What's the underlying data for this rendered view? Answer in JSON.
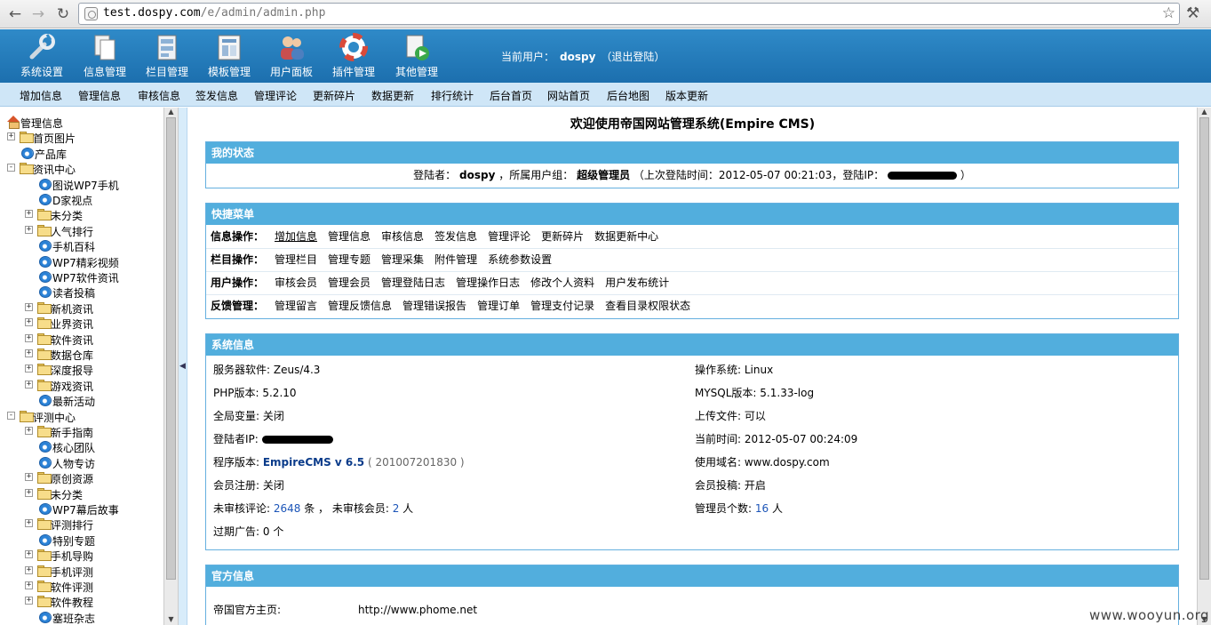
{
  "browser": {
    "url_host": "test.dospy.com",
    "url_path": "/e/admin/admin.php"
  },
  "topbar": {
    "items": [
      {
        "label": "系统设置",
        "icon": "wrench-icon"
      },
      {
        "label": "信息管理",
        "icon": "documents-icon"
      },
      {
        "label": "栏目管理",
        "icon": "column-icon"
      },
      {
        "label": "模板管理",
        "icon": "template-icon"
      },
      {
        "label": "用户面板",
        "icon": "users-icon"
      },
      {
        "label": "插件管理",
        "icon": "lifebuoy-icon"
      },
      {
        "label": "其他管理",
        "icon": "play-document-icon"
      }
    ],
    "user_prefix": "当前用户：",
    "user_name": "dospy",
    "logout": "（退出登陆）"
  },
  "subnav": [
    "增加信息",
    "管理信息",
    "审核信息",
    "签发信息",
    "管理评论",
    "更新碎片",
    "数据更新",
    "排行统计",
    "后台首页",
    "网站首页",
    "后台地图",
    "版本更新"
  ],
  "tree": [
    {
      "label": "管理信息",
      "level": 0,
      "icon": "home",
      "exp": ""
    },
    {
      "label": "首页图片",
      "level": 1,
      "icon": "folder",
      "exp": "+"
    },
    {
      "label": "产品库",
      "level": 1,
      "icon": "ie",
      "exp": ""
    },
    {
      "label": "资讯中心",
      "level": 1,
      "icon": "folder",
      "exp": "-"
    },
    {
      "label": "图说WP7手机",
      "level": 2,
      "icon": "ie",
      "exp": ""
    },
    {
      "label": "D家视点",
      "level": 2,
      "icon": "ie",
      "exp": ""
    },
    {
      "label": "未分类",
      "level": 2,
      "icon": "folder",
      "exp": "+"
    },
    {
      "label": "人气排行",
      "level": 2,
      "icon": "folder",
      "exp": "+"
    },
    {
      "label": "手机百科",
      "level": 2,
      "icon": "ie",
      "exp": ""
    },
    {
      "label": "WP7精彩视频",
      "level": 2,
      "icon": "ie",
      "exp": ""
    },
    {
      "label": "WP7软件资讯",
      "level": 2,
      "icon": "ie",
      "exp": ""
    },
    {
      "label": "读者投稿",
      "level": 2,
      "icon": "ie",
      "exp": ""
    },
    {
      "label": "新机资讯",
      "level": 2,
      "icon": "folder",
      "exp": "+"
    },
    {
      "label": "业界资讯",
      "level": 2,
      "icon": "folder",
      "exp": "+"
    },
    {
      "label": "软件资讯",
      "level": 2,
      "icon": "folder",
      "exp": "+"
    },
    {
      "label": "数据仓库",
      "level": 2,
      "icon": "folder",
      "exp": "+"
    },
    {
      "label": "深度报导",
      "level": 2,
      "icon": "folder",
      "exp": "+"
    },
    {
      "label": "游戏资讯",
      "level": 2,
      "icon": "folder",
      "exp": "+"
    },
    {
      "label": "最新活动",
      "level": 2,
      "icon": "ie",
      "exp": ""
    },
    {
      "label": "评测中心",
      "level": 1,
      "icon": "folder",
      "exp": "-"
    },
    {
      "label": "新手指南",
      "level": 2,
      "icon": "folder",
      "exp": "+"
    },
    {
      "label": "核心团队",
      "level": 2,
      "icon": "ie",
      "exp": ""
    },
    {
      "label": "人物专访",
      "level": 2,
      "icon": "ie",
      "exp": ""
    },
    {
      "label": "原创资源",
      "level": 2,
      "icon": "folder",
      "exp": "+"
    },
    {
      "label": "未分类",
      "level": 2,
      "icon": "folder",
      "exp": "+"
    },
    {
      "label": "WP7幕后故事",
      "level": 2,
      "icon": "ie",
      "exp": ""
    },
    {
      "label": "评测排行",
      "level": 2,
      "icon": "folder",
      "exp": "+"
    },
    {
      "label": "特别专题",
      "level": 2,
      "icon": "ie",
      "exp": ""
    },
    {
      "label": "手机导购",
      "level": 2,
      "icon": "folder",
      "exp": "+"
    },
    {
      "label": "手机评测",
      "level": 2,
      "icon": "folder",
      "exp": "+"
    },
    {
      "label": "软件评测",
      "level": 2,
      "icon": "folder",
      "exp": "+"
    },
    {
      "label": "软件教程",
      "level": 2,
      "icon": "folder",
      "exp": "+"
    },
    {
      "label": "塞班杂志",
      "level": 2,
      "icon": "ie",
      "exp": ""
    }
  ],
  "main": {
    "welcome": "欢迎使用帝国网站管理系统(Empire CMS)",
    "status": {
      "title": "我的状态",
      "login_label": "登陆者：",
      "login_user": "dospy",
      "group_label": "，所属用户组：",
      "group": "超级管理员",
      "last_login": "（上次登陆时间：",
      "last_time": "2012-05-07 00:21:03",
      "ip_label": "，登陆IP：",
      "close": "）"
    },
    "quick": {
      "title": "快捷菜单",
      "rows": [
        {
          "label": "信息操作：",
          "links": [
            "增加信息",
            "管理信息",
            "审核信息",
            "签发信息",
            "管理评论",
            "更新碎片",
            "数据更新中心"
          ]
        },
        {
          "label": "栏目操作：",
          "links": [
            "管理栏目",
            "管理专题",
            "管理采集",
            "附件管理",
            "系统参数设置"
          ]
        },
        {
          "label": "用户操作：",
          "links": [
            "审核会员",
            "管理会员",
            "管理登陆日志",
            "管理操作日志",
            "修改个人资料",
            "用户发布统计"
          ]
        },
        {
          "label": "反馈管理：",
          "links": [
            "管理留言",
            "管理反馈信息",
            "管理错误报告",
            "管理订单",
            "管理支付记录",
            "查看目录权限状态"
          ]
        }
      ]
    },
    "sysinfo": {
      "title": "系统信息",
      "server": "服务器软件: Zeus/4.3",
      "os": "操作系统: Linux",
      "php": "PHP版本: 5.2.10",
      "mysql": "MYSQL版本: 5.1.33-log",
      "globals": "全局变量: 关闭",
      "upload": "上传文件: 可以",
      "ip_label": "登陆者IP:",
      "now": "当前时间: 2012-05-07 00:24:09",
      "ver_label": "程序版本: ",
      "ver": "EmpireCMS v 6.5",
      "ver_build": "( 201007201830 )",
      "domain": "使用域名: www.dospy.com",
      "reg": "会员注册: 关闭",
      "submit": "会员投稿: 开启",
      "pending_label": "未审核评论: ",
      "pending_count": "2648",
      "pending_unit": " 条 ， 未审核会员: ",
      "pending_members": "2",
      "pending_members_unit": " 人",
      "admins_label": "管理员个数: ",
      "admins": "16",
      "admins_unit": " 人",
      "ads_label": "过期广告: ",
      "ads": "0",
      "ads_unit": " 个"
    },
    "official": {
      "title": "官方信息",
      "home_label": "帝国官方主页:",
      "home_url": "http://www.phome.net"
    }
  },
  "watermark": "www.wooyun.org"
}
